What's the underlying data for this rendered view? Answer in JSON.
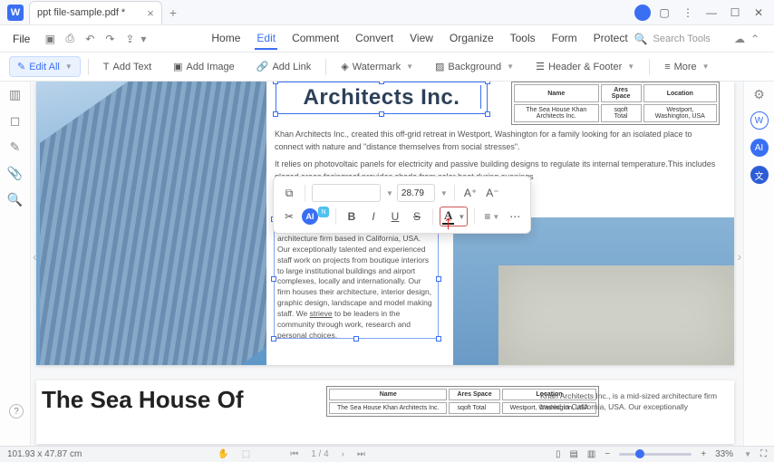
{
  "titlebar": {
    "logo": "W",
    "tab_name": "ppt file-sample.pdf *"
  },
  "menubar": {
    "file": "File",
    "tabs": [
      "Home",
      "Edit",
      "Comment",
      "Convert",
      "View",
      "Organize",
      "Tools",
      "Form",
      "Protect"
    ],
    "active_tab": "Edit",
    "search_placeholder": "Search Tools"
  },
  "ribbon": {
    "edit_all": "Edit All",
    "add_text": "Add Text",
    "add_image": "Add Image",
    "add_link": "Add Link",
    "watermark": "Watermark",
    "background": "Background",
    "header_footer": "Header & Footer",
    "more": "More"
  },
  "document": {
    "title": "Architects Inc.",
    "spec_table_1": {
      "headers": [
        "Name",
        "Ares Space",
        "Location"
      ],
      "rows": [
        [
          "The Sea House Khan Architects Inc.",
          "sqoft Total",
          "Westport, Washington, USA"
        ]
      ]
    },
    "paragraph1": "Khan Architects Inc., created this off-grid retreat in Westport, Washington for a family looking for an isolated place to connect with nature and \"distance themselves from social stresses\".",
    "paragraph2": "It relies on photovoltaic panels for electricity and passive building designs to regulate its internal temperature.This includes glazed areas facingroof provides shade from solar heat during evenings",
    "selected_text_start": "Khan Architects",
    "selected_para": " Inc., is a mid-sized architecture firm based in California, USA. Our exceptionally talented and experienced staff work on projects from boutique interiors to large institutional buildings and airport complexes, locally and internationally. Our firm houses their architecture, interior design, graphic design, landscape and model making staff. We ",
    "selected_link": "strieve",
    "selected_para_end": " to be leaders in the community through work, research and personal choices.",
    "page2_title": "The Sea House Of",
    "p2_text": "Khan Architects Inc., is a mid-sized architecture firm based in California, USA. Our exceptionally"
  },
  "floating_toolbar": {
    "font_size": "28.79"
  },
  "statusbar": {
    "dims": "101.93 x 47.87 cm",
    "page": "1 / 4",
    "zoom": "33%"
  }
}
